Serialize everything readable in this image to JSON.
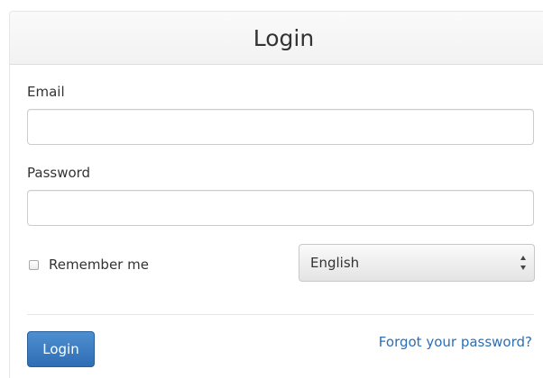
{
  "header": {
    "title": "Login"
  },
  "form": {
    "email_label": "Email",
    "email_value": "",
    "password_label": "Password",
    "password_value": "",
    "remember_label": "Remember me",
    "remember_checked": false,
    "language_selected": "English",
    "login_button_label": "Login",
    "forgot_link_label": "Forgot your password?"
  },
  "colors": {
    "primary_button": "#3a7cc4",
    "link": "#2a6fb8"
  }
}
